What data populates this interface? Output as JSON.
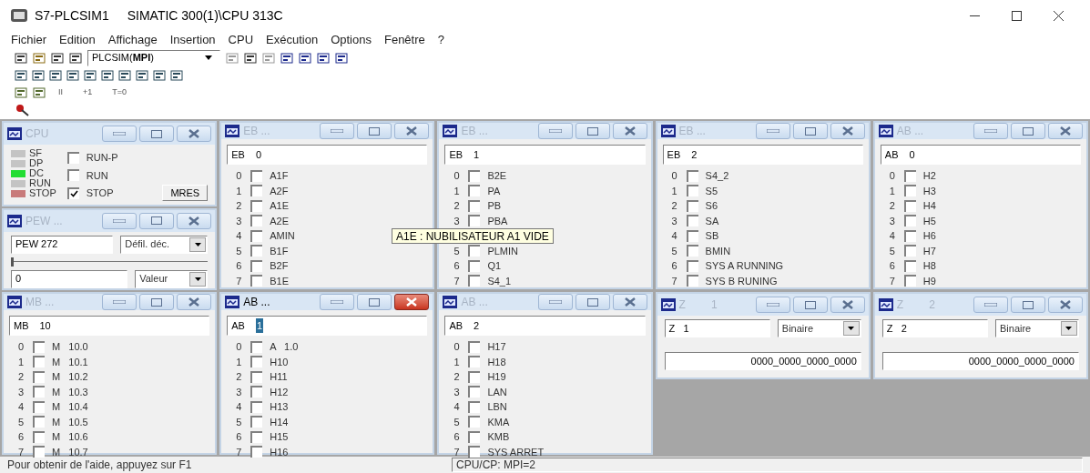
{
  "window": {
    "title": "S7-PLCSIM1",
    "subtitle": "SIMATIC 300(1)\\CPU 313C"
  },
  "menu": [
    "Fichier",
    "Edition",
    "Affichage",
    "Insertion",
    "CPU",
    "Exécution",
    "Options",
    "Fenêtre",
    "?"
  ],
  "toolbar": {
    "connection": "PLCSIM(**MPI**)",
    "sim_buttons": [
      "II",
      "+1",
      "T=0"
    ]
  },
  "cpu_window": {
    "title": "CPU",
    "active": false,
    "leds": [
      {
        "label": "SF",
        "color": "#c4c4c4"
      },
      {
        "label": "DP",
        "color": "#c4c4c4"
      },
      {
        "label": "DC",
        "color": "#22dd33"
      },
      {
        "label": "RUN",
        "color": "#c4c4c4"
      },
      {
        "label": "STOP",
        "color": "#c87a7a"
      }
    ],
    "modes": [
      {
        "label": "RUN-P",
        "checked": false
      },
      {
        "label": "RUN",
        "checked": false
      },
      {
        "label": "STOP",
        "checked": true
      }
    ],
    "mres": "MRES"
  },
  "pew_window": {
    "title": "PEW ...",
    "active": false,
    "address": "PEW 272",
    "format": "Défil. déc.",
    "level": 0,
    "value": "0",
    "value_format": "Valeur"
  },
  "byte_windows": [
    {
      "title": "EB ...",
      "active": false,
      "area": "EB",
      "number": "0",
      "number_selected": false,
      "bits": [
        {
          "bit": "0",
          "label": "A1F",
          "checked": false
        },
        {
          "bit": "1",
          "label": "A2F",
          "checked": false
        },
        {
          "bit": "2",
          "label": "A1E",
          "checked": false
        },
        {
          "bit": "3",
          "label": "A2E",
          "checked": false
        },
        {
          "bit": "4",
          "label": "AMIN",
          "checked": false
        },
        {
          "bit": "5",
          "label": "B1F",
          "checked": false
        },
        {
          "bit": "6",
          "label": "B2F",
          "checked": false
        },
        {
          "bit": "7",
          "label": "B1E",
          "checked": false
        }
      ]
    },
    {
      "title": "EB ...",
      "active": false,
      "area": "EB",
      "number": "1",
      "number_selected": false,
      "bits": [
        {
          "bit": "0",
          "label": "B2E",
          "checked": false
        },
        {
          "bit": "1",
          "label": "PA",
          "checked": false
        },
        {
          "bit": "2",
          "label": "PB",
          "checked": false
        },
        {
          "bit": "3",
          "label": "PBA",
          "checked": false
        },
        {
          "bit": "5",
          "label": "PLMIN",
          "checked": false
        },
        {
          "bit": "6",
          "label": "Q1",
          "checked": false
        },
        {
          "bit": "7",
          "label": "S4_1",
          "checked": false
        }
      ]
    },
    {
      "title": "EB ...",
      "active": false,
      "area": "EB",
      "number": "2",
      "number_selected": false,
      "bits": [
        {
          "bit": "0",
          "label": "S4_2",
          "checked": false
        },
        {
          "bit": "1",
          "label": "S5",
          "checked": false
        },
        {
          "bit": "2",
          "label": "S6",
          "checked": false
        },
        {
          "bit": "3",
          "label": "SA",
          "checked": false
        },
        {
          "bit": "4",
          "label": "SB",
          "checked": false
        },
        {
          "bit": "5",
          "label": "BMIN",
          "checked": false
        },
        {
          "bit": "6",
          "label": "SYS A RUNNING",
          "checked": false
        },
        {
          "bit": "7",
          "label": "SYS B RUNING",
          "checked": false
        }
      ]
    },
    {
      "title": "AB ...",
      "active": false,
      "area": "AB",
      "number": "0",
      "number_selected": false,
      "bits": [
        {
          "bit": "0",
          "label": "H2",
          "checked": false
        },
        {
          "bit": "1",
          "label": "H3",
          "checked": false
        },
        {
          "bit": "2",
          "label": "H4",
          "checked": false
        },
        {
          "bit": "3",
          "label": "H5",
          "checked": false
        },
        {
          "bit": "4",
          "label": "H6",
          "checked": false
        },
        {
          "bit": "5",
          "label": "H7",
          "checked": false
        },
        {
          "bit": "6",
          "label": "H8",
          "checked": false
        },
        {
          "bit": "7",
          "label": "H9",
          "checked": false
        }
      ]
    },
    {
      "title": "MB ...",
      "active": false,
      "area": "MB",
      "number": "10",
      "number_selected": false,
      "bits": [
        {
          "bit": "0",
          "label": "M   10.0",
          "checked": false
        },
        {
          "bit": "1",
          "label": "M   10.1",
          "checked": false
        },
        {
          "bit": "2",
          "label": "M   10.2",
          "checked": false
        },
        {
          "bit": "3",
          "label": "M   10.3",
          "checked": false
        },
        {
          "bit": "4",
          "label": "M   10.4",
          "checked": false
        },
        {
          "bit": "5",
          "label": "M   10.5",
          "checked": false
        },
        {
          "bit": "6",
          "label": "M   10.6",
          "checked": false
        },
        {
          "bit": "7",
          "label": "M   10.7",
          "checked": false
        }
      ]
    },
    {
      "title": "AB ...",
      "active": true,
      "area": "AB",
      "number": "1",
      "number_selected": true,
      "bits": [
        {
          "bit": "0",
          "label": "A   1.0",
          "checked": false
        },
        {
          "bit": "1",
          "label": "H10",
          "checked": false
        },
        {
          "bit": "2",
          "label": "H11",
          "checked": false
        },
        {
          "bit": "3",
          "label": "H12",
          "checked": false
        },
        {
          "bit": "4",
          "label": "H13",
          "checked": false
        },
        {
          "bit": "5",
          "label": "H14",
          "checked": false
        },
        {
          "bit": "6",
          "label": "H15",
          "checked": false
        },
        {
          "bit": "7",
          "label": "H16",
          "checked": false
        }
      ]
    },
    {
      "title": "AB ...",
      "active": false,
      "area": "AB",
      "number": "2",
      "number_selected": false,
      "bits": [
        {
          "bit": "0",
          "label": "H17",
          "checked": false
        },
        {
          "bit": "1",
          "label": "H18",
          "checked": false
        },
        {
          "bit": "2",
          "label": "H19",
          "checked": false
        },
        {
          "bit": "3",
          "label": "LAN",
          "checked": false
        },
        {
          "bit": "4",
          "label": "LBN",
          "checked": false
        },
        {
          "bit": "5",
          "label": "KMA",
          "checked": false
        },
        {
          "bit": "6",
          "label": "KMB",
          "checked": false
        },
        {
          "bit": "7",
          "label": "SYS ARRET",
          "checked": false
        }
      ]
    }
  ],
  "counter_windows": [
    {
      "title": "Z",
      "title_number": "1",
      "active": false,
      "address": "Z   1",
      "format": "Binaire",
      "value": "0000_0000_0000_0000"
    },
    {
      "title": "Z",
      "title_number": "2",
      "active": false,
      "address": "Z   2",
      "format": "Binaire",
      "value": "0000_0000_0000_0000"
    }
  ],
  "tooltip": "A1E : NUBILISATEUR A1 VIDE",
  "status_bar": {
    "help": "Pour obtenir de l'aide, appuyez sur F1",
    "connection": "CPU/CP:  MPI=2"
  }
}
